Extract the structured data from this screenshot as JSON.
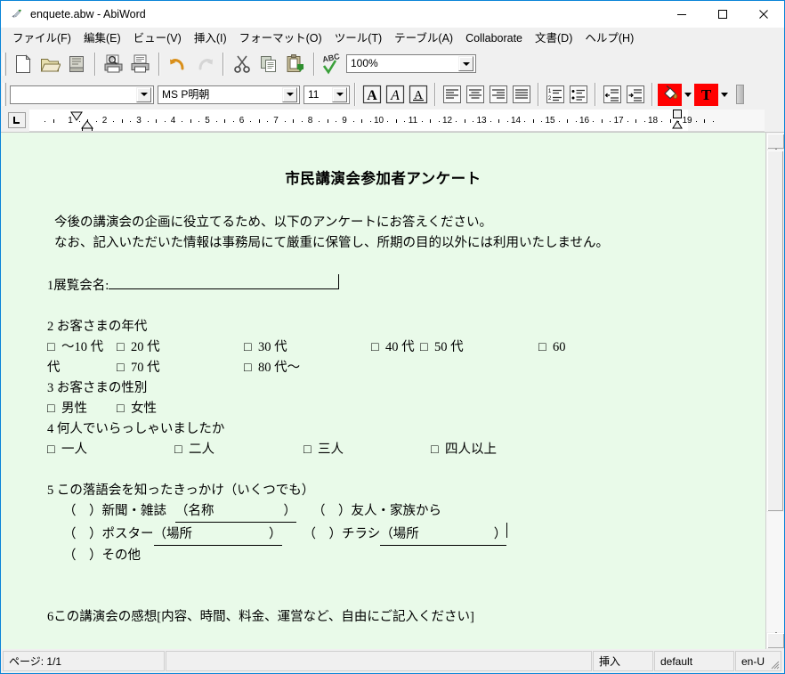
{
  "window": {
    "title": "enquete.abw - AbiWord",
    "icon": "abiword-icon",
    "minimize_label": "—",
    "maximize_label": "□",
    "close_label": "✕"
  },
  "menubar": {
    "items": [
      {
        "label": "ファイル(F)",
        "name": "menu-file"
      },
      {
        "label": "編集(E)",
        "name": "menu-edit"
      },
      {
        "label": "ビュー(V)",
        "name": "menu-view"
      },
      {
        "label": "挿入(I)",
        "name": "menu-insert"
      },
      {
        "label": "フォーマット(O)",
        "name": "menu-format"
      },
      {
        "label": "ツール(T)",
        "name": "menu-tools"
      },
      {
        "label": "テーブル(A)",
        "name": "menu-table"
      },
      {
        "label": "Collaborate",
        "name": "menu-collaborate"
      },
      {
        "label": "文書(D)",
        "name": "menu-document"
      },
      {
        "label": "ヘルプ(H)",
        "name": "menu-help"
      }
    ]
  },
  "toolbar_main": {
    "buttons": [
      {
        "name": "new-document-button",
        "icon": "new-file-icon"
      },
      {
        "name": "open-document-button",
        "icon": "folder-open-icon"
      },
      {
        "name": "save-document-button",
        "icon": "save-icon"
      },
      {
        "name": "print-preview-button",
        "icon": "print-preview-icon"
      },
      {
        "name": "print-button",
        "icon": "printer-icon"
      },
      {
        "name": "undo-button",
        "icon": "undo-arrow-icon"
      },
      {
        "name": "redo-button",
        "icon": "redo-arrow-icon"
      },
      {
        "name": "cut-button",
        "icon": "scissors-icon"
      },
      {
        "name": "copy-button",
        "icon": "copy-icon"
      },
      {
        "name": "paste-button",
        "icon": "paste-icon"
      },
      {
        "name": "spellcheck-button",
        "icon": "abc-check-icon"
      }
    ],
    "zoom": {
      "value": "100%",
      "name": "zoom-combo"
    }
  },
  "toolbar_format": {
    "style_combo": {
      "value": "",
      "name": "paragraph-style-combo"
    },
    "font_combo": {
      "value": "MS P明朝",
      "name": "font-family-combo"
    },
    "size_combo": {
      "value": "11",
      "name": "font-size-combo"
    },
    "buttons": [
      {
        "name": "bold-button",
        "label": "A"
      },
      {
        "name": "italic-button",
        "label": "A"
      },
      {
        "name": "underline-button",
        "label": "A"
      }
    ],
    "align": [
      {
        "name": "align-left-button",
        "icon": "align-left-icon"
      },
      {
        "name": "align-center-button",
        "icon": "align-center-icon"
      },
      {
        "name": "align-right-button",
        "icon": "align-right-icon"
      },
      {
        "name": "align-justify-button",
        "icon": "align-justify-icon"
      }
    ],
    "lists": [
      {
        "name": "numbered-list-button",
        "icon": "numbered-list-icon"
      },
      {
        "name": "bulleted-list-button",
        "icon": "bulleted-list-icon"
      }
    ],
    "indent": [
      {
        "name": "decrease-indent-button",
        "icon": "decrease-indent-icon"
      },
      {
        "name": "increase-indent-button",
        "icon": "increase-indent-icon"
      }
    ],
    "colors": {
      "highlight": {
        "name": "highlight-color-button",
        "icon": "paint-bucket-icon",
        "color": "#ff0000"
      },
      "text_color": {
        "name": "text-color-button",
        "icon": "text-color-T-icon",
        "color": "#ff0000",
        "glyph": "T"
      }
    }
  },
  "ruler": {
    "unit_labels": [
      "1",
      "2",
      "3",
      "4",
      "5",
      "6",
      "7",
      "8",
      "9",
      "10",
      "11",
      "12",
      "13",
      "14",
      "15",
      "16",
      "17",
      "18",
      "19"
    ],
    "tab_selector": "left-tab-stop-icon"
  },
  "document": {
    "background_color": "#e9fae9",
    "title": "市民講演会参加者アンケート",
    "intro_line1": "今後の講演会の企画に役立てるため、以下のアンケートにお答えください。",
    "intro_line2": "なお、記入いただいた情報は事務局にて厳重に保管し、所期の目的以外には利用いたしません。",
    "q1": {
      "label": "1展覧会名:",
      "blank": ""
    },
    "q2": {
      "label": "2 お客さまの年代",
      "row1": [
        {
          "box": "□",
          "text": "～10 代"
        },
        {
          "box": "□",
          "text": "20 代"
        },
        {
          "box": "□",
          "text": "30 代"
        },
        {
          "box": "□",
          "text": "40 代"
        },
        {
          "box": "□",
          "text": "50 代"
        },
        {
          "box": "□",
          "text": "60"
        }
      ],
      "row2_prefix": "代",
      "row2": [
        {
          "box": "□",
          "text": "70 代"
        },
        {
          "box": "□",
          "text": "80 代～"
        }
      ]
    },
    "q3": {
      "label": "3 お客さまの性別",
      "options": [
        {
          "box": "□",
          "text": "男性"
        },
        {
          "box": "□",
          "text": "女性"
        }
      ]
    },
    "q4": {
      "label": "4 何人でいらっしゃいましたか",
      "options": [
        {
          "box": "□",
          "text": "一人"
        },
        {
          "box": "□",
          "text": "二人"
        },
        {
          "box": "□",
          "text": "三人"
        },
        {
          "box": "□",
          "text": "四人以上"
        }
      ]
    },
    "q5": {
      "label": "5 この落語会を知ったきっかけ（いくつでも）",
      "opt1": {
        "paren": "（　）",
        "text": "新聞・雑誌",
        "field_open": "（名称",
        "field_close": "）"
      },
      "opt2": {
        "paren": "（　）",
        "text": "友人・家族から"
      },
      "opt3": {
        "paren": "（　）",
        "text": "ポスター",
        "field_open": "（場所",
        "field_close": "）"
      },
      "opt4": {
        "paren": "（　）",
        "text": "チラシ",
        "field_open": "（場所",
        "field_close": "）"
      },
      "opt5": {
        "paren": "（　）",
        "text": "その他"
      }
    },
    "q6": {
      "label": "6この講演会の感想[内容、時間、料金、運営など、自由にご記入ください]"
    }
  },
  "statusbar": {
    "page": "ページ: 1/1",
    "message": "",
    "insert_mode": "挿入",
    "style": "default",
    "language": "en-U"
  }
}
